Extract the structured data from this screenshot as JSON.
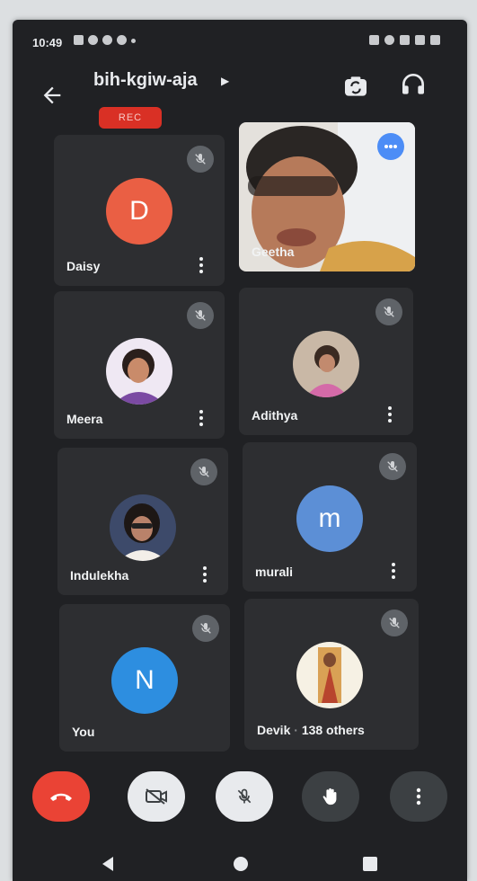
{
  "status_bar": {
    "time": "10:49"
  },
  "header": {
    "meeting_code": "bih-kgiw-aja",
    "rec_label": "REC"
  },
  "participants": [
    {
      "name": "Daisy",
      "initial": "D",
      "avatar_color": "#ea5f44"
    },
    {
      "name": "Geetha"
    },
    {
      "name": "Meera"
    },
    {
      "name": "Adithya"
    },
    {
      "name": "Indulekha"
    },
    {
      "name": "murali",
      "initial": "m",
      "avatar_color": "#5c8fd6"
    },
    {
      "name": "You",
      "initial": "N",
      "avatar_color": "#2d8ee0"
    },
    {
      "name": "Devik",
      "others_label": "138 others"
    }
  ],
  "colors": {
    "background": "#202124",
    "tile": "#2d2e31",
    "end_call": "#ea4335",
    "control_light": "#e8eaed",
    "control_dark": "#3c4043"
  },
  "controls": {
    "icons": [
      "phone-end-icon",
      "camera-off-icon",
      "mic-off-icon",
      "hand-raise-icon",
      "more-options-icon"
    ]
  }
}
